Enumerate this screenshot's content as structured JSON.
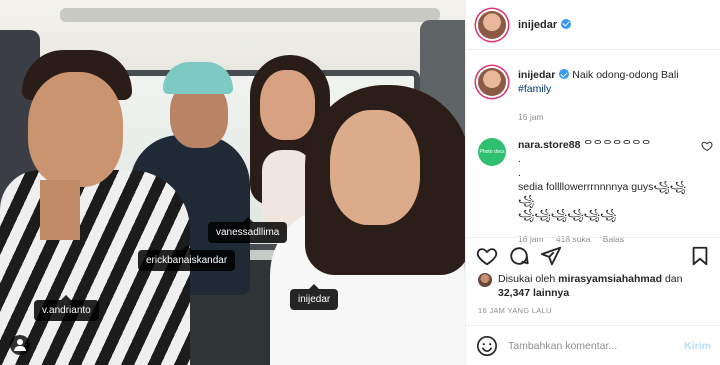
{
  "post": {
    "tags": [
      "vanessadllima",
      "erickbanaiskandar",
      "v.andrianto",
      "inijedar"
    ]
  },
  "header": {
    "username": "inijedar"
  },
  "caption": {
    "username": "inijedar",
    "text": "Naik odong-odong Bali",
    "hashtag": "#family",
    "time": "16 jam"
  },
  "comment": {
    "avatar_text": "Photo docs",
    "username": "nara.store88",
    "line1": "ᄋᄋᄋᄋᄋᄋᄋ",
    "line2": ".",
    "line3": ".",
    "line4": "sedia follllowerrrnnnnya guys꧁꧁꧁",
    "line5": "꧁꧁꧁꧁꧁꧁",
    "time": "16 jam",
    "likes": "418 suka",
    "reply": "Balas"
  },
  "likes": {
    "prefix": "Disukai oleh",
    "user": "mirasyamsiahahmad",
    "middle": "dan",
    "count": "32,347 lainnya"
  },
  "time_ago": "16 JAM YANG LALU",
  "add_comment": {
    "placeholder": "Tambahkan komentar...",
    "post_label": "Kirim"
  },
  "colors": {
    "accent": "#3897f0",
    "hashtag": "#00376b",
    "muted": "#8e8e8e",
    "post_button": "#b2dffc"
  }
}
